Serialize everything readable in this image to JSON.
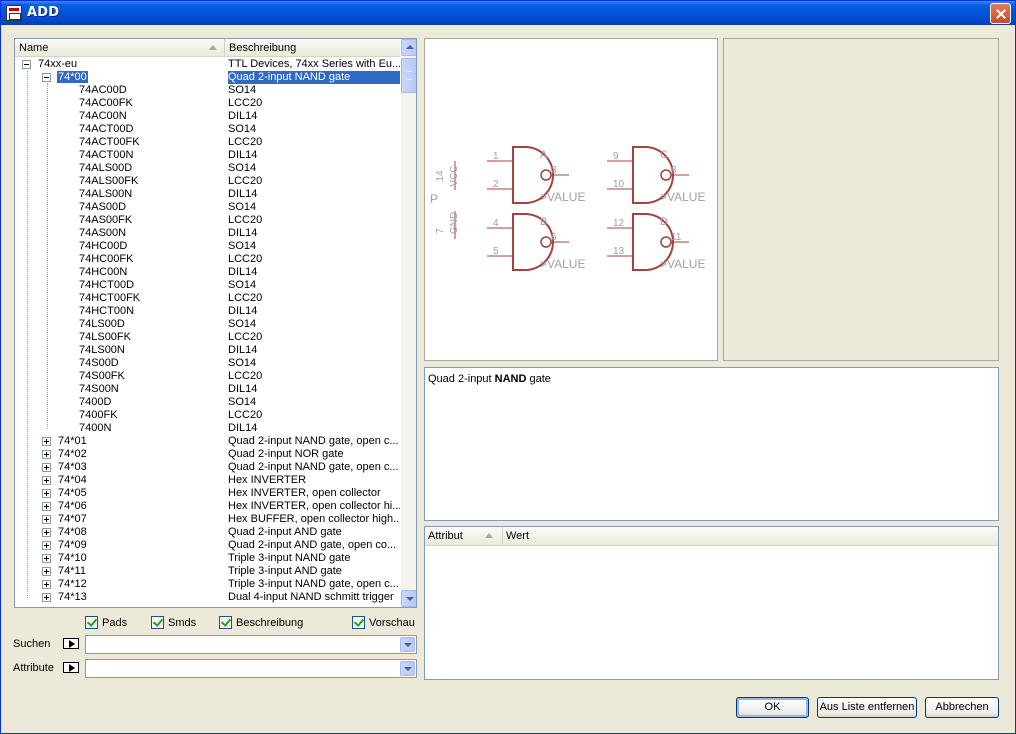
{
  "window": {
    "title": "ADD"
  },
  "tree": {
    "columns": {
      "name": "Name",
      "description": "Beschreibung"
    },
    "rows": [
      {
        "level": 0,
        "expander": "minus",
        "name": "74xx-eu",
        "desc": "TTL Devices, 74xx Series with Eu..."
      },
      {
        "level": 1,
        "expander": "minus",
        "name": "74*00",
        "desc": "Quad 2-input NAND gate",
        "selected": true
      },
      {
        "level": 2,
        "name": "74AC00D",
        "desc": "SO14"
      },
      {
        "level": 2,
        "name": "74AC00FK",
        "desc": "LCC20"
      },
      {
        "level": 2,
        "name": "74AC00N",
        "desc": "DIL14"
      },
      {
        "level": 2,
        "name": "74ACT00D",
        "desc": "SO14"
      },
      {
        "level": 2,
        "name": "74ACT00FK",
        "desc": "LCC20"
      },
      {
        "level": 2,
        "name": "74ACT00N",
        "desc": "DIL14"
      },
      {
        "level": 2,
        "name": "74ALS00D",
        "desc": "SO14"
      },
      {
        "level": 2,
        "name": "74ALS00FK",
        "desc": "LCC20"
      },
      {
        "level": 2,
        "name": "74ALS00N",
        "desc": "DIL14"
      },
      {
        "level": 2,
        "name": "74AS00D",
        "desc": "SO14"
      },
      {
        "level": 2,
        "name": "74AS00FK",
        "desc": "LCC20"
      },
      {
        "level": 2,
        "name": "74AS00N",
        "desc": "DIL14"
      },
      {
        "level": 2,
        "name": "74HC00D",
        "desc": "SO14"
      },
      {
        "level": 2,
        "name": "74HC00FK",
        "desc": "LCC20"
      },
      {
        "level": 2,
        "name": "74HC00N",
        "desc": "DIL14"
      },
      {
        "level": 2,
        "name": "74HCT00D",
        "desc": "SO14"
      },
      {
        "level": 2,
        "name": "74HCT00FK",
        "desc": "LCC20"
      },
      {
        "level": 2,
        "name": "74HCT00N",
        "desc": "DIL14"
      },
      {
        "level": 2,
        "name": "74LS00D",
        "desc": "SO14"
      },
      {
        "level": 2,
        "name": "74LS00FK",
        "desc": "LCC20"
      },
      {
        "level": 2,
        "name": "74LS00N",
        "desc": "DIL14"
      },
      {
        "level": 2,
        "name": "74S00D",
        "desc": "SO14"
      },
      {
        "level": 2,
        "name": "74S00FK",
        "desc": "LCC20"
      },
      {
        "level": 2,
        "name": "74S00N",
        "desc": "DIL14"
      },
      {
        "level": 2,
        "name": "7400D",
        "desc": "SO14"
      },
      {
        "level": 2,
        "name": "7400FK",
        "desc": "LCC20"
      },
      {
        "level": 2,
        "name": "7400N",
        "desc": "DIL14"
      },
      {
        "level": 1,
        "expander": "plus",
        "name": "74*01",
        "desc": "Quad 2-input NAND gate, open c..."
      },
      {
        "level": 1,
        "expander": "plus",
        "name": "74*02",
        "desc": "Quad 2-input NOR gate"
      },
      {
        "level": 1,
        "expander": "plus",
        "name": "74*03",
        "desc": "Quad 2-input NAND gate, open c..."
      },
      {
        "level": 1,
        "expander": "plus",
        "name": "74*04",
        "desc": "Hex INVERTER"
      },
      {
        "level": 1,
        "expander": "plus",
        "name": "74*05",
        "desc": "Hex INVERTER, open collector"
      },
      {
        "level": 1,
        "expander": "plus",
        "name": "74*06",
        "desc": "Hex INVERTER, open collector hi..."
      },
      {
        "level": 1,
        "expander": "plus",
        "name": "74*07",
        "desc": "Hex BUFFER, open collector high..."
      },
      {
        "level": 1,
        "expander": "plus",
        "name": "74*08",
        "desc": "Quad 2-input AND gate"
      },
      {
        "level": 1,
        "expander": "plus",
        "name": "74*09",
        "desc": "Quad 2-input AND gate, open co..."
      },
      {
        "level": 1,
        "expander": "plus",
        "name": "74*10",
        "desc": "Triple 3-input NAND gate"
      },
      {
        "level": 1,
        "expander": "plus",
        "name": "74*11",
        "desc": "Triple 3-input AND gate"
      },
      {
        "level": 1,
        "expander": "plus",
        "name": "74*12",
        "desc": "Triple 3-input NAND gate, open c..."
      },
      {
        "level": 1,
        "expander": "plus",
        "name": "74*13",
        "desc": "Dual 4-input NAND schmitt trigger"
      }
    ]
  },
  "options": {
    "pads": {
      "label": "Pads",
      "checked": true
    },
    "smds": {
      "label": "Smds",
      "checked": true
    },
    "description": {
      "label": "Beschreibung",
      "checked": true
    },
    "preview": {
      "label": "Vorschau",
      "checked": true
    }
  },
  "search": {
    "label": "Suchen",
    "value": ""
  },
  "attributes_filter": {
    "label": "Attribute",
    "value": ""
  },
  "symbol_preview": {
    "color": "#a5413f",
    "label_color": "#a0a0a0",
    "power": {
      "vcc_pin": "14",
      "vcc_label": "VCC",
      "gnd_pin": "7",
      "gnd_label": "GND",
      "name": "P"
    },
    "gates": [
      {
        "name": "A",
        "in1": "1",
        "in2": "2",
        "out": "3",
        "value": ">VALUE"
      },
      {
        "name": "B",
        "in1": "4",
        "in2": "5",
        "out": "6",
        "value": ">VALUE"
      },
      {
        "name": "C",
        "in1": "9",
        "in2": "10",
        "out": "8",
        "value": ">VALUE"
      },
      {
        "name": "D",
        "in1": "12",
        "in2": "13",
        "out": "11",
        "value": ">VALUE"
      }
    ]
  },
  "description_panel": {
    "prefix": "Quad 2-input ",
    "bold": "NAND",
    "suffix": " gate"
  },
  "attributes_table": {
    "col_attribute": "Attribut",
    "col_value": "Wert"
  },
  "buttons": {
    "ok": "OK",
    "remove": "Aus Liste entfernen",
    "cancel": "Abbrechen"
  }
}
